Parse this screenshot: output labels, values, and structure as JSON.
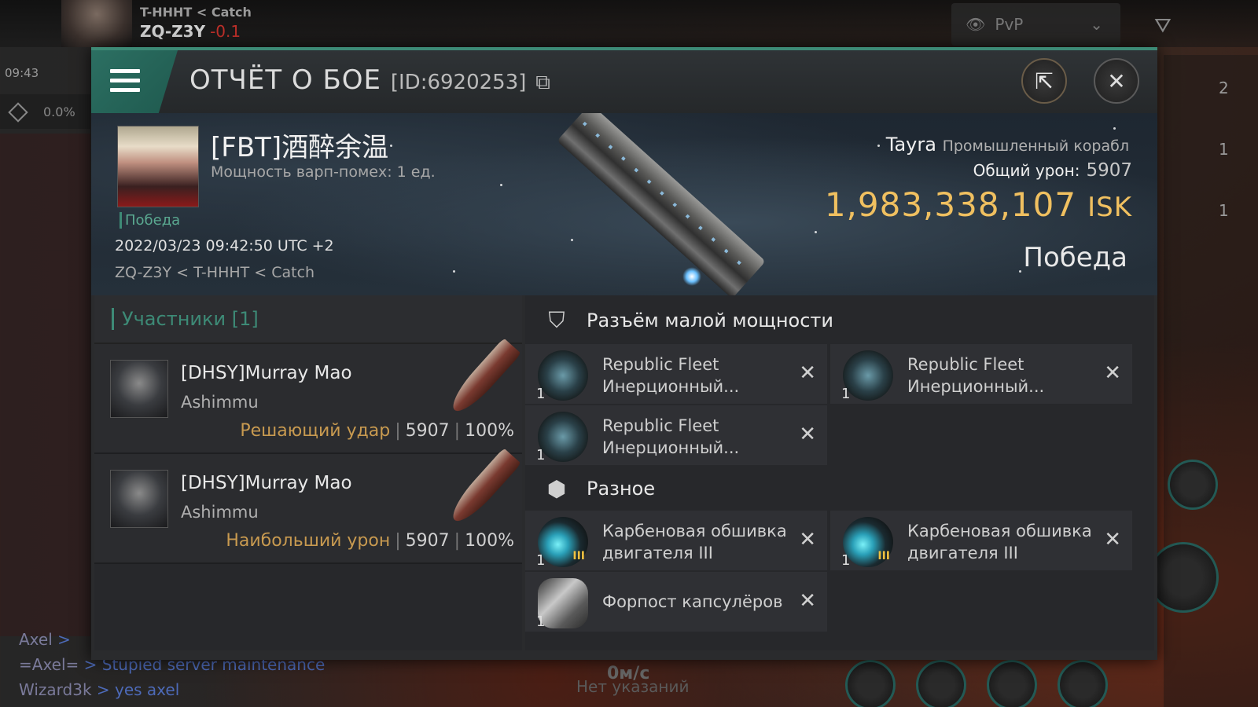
{
  "background": {
    "system_sub": "T-HHHT",
    "system_sub_arrow": "<",
    "system_sub_catch": "Catch",
    "system_name": "ZQ-Z3Y",
    "system_security": "-0.1",
    "clock": "09:43",
    "percent": "0.0%",
    "pvp_label": "PvP",
    "right_counts": [
      "2",
      "1",
      "1"
    ],
    "chat": [
      {
        "name": "Axel",
        "text": "> "
      },
      {
        "name": "=Axel=",
        "text": "> Stupied server maintenance"
      },
      {
        "name": "Wizard3k",
        "text": "> yes axel"
      }
    ],
    "speed": "0м/с",
    "no_target": "Нет указаний"
  },
  "header": {
    "title": "ОТЧЁТ О БОЕ",
    "report_id": "[ID:6920253]",
    "copy_icon": "copy-icon",
    "share_icon": "share-icon",
    "close_icon": "close-icon"
  },
  "victim": {
    "name": "[FBT]酒醉余温",
    "warp_disruption": "Мощность варп-помех: 1 ед.",
    "result_tag": "Победа",
    "datetime": "2022/03/23 09:42:50 UTC +2",
    "location": "ZQ-Z3Y < T-HHHT < Catch",
    "ship_name": "Tayra",
    "ship_class": "Промышленный корабл",
    "total_damage_label": "Общий урон:",
    "total_damage": "5907",
    "isk_value": "1,983,338,107",
    "isk_unit": "ISK",
    "outcome": "Победа"
  },
  "participants": {
    "header": "Участники [1]",
    "rows": [
      {
        "name": "[DHSY]Murray Mao",
        "ship": "Ashimmu",
        "role": "Решающий удар",
        "damage": "5907",
        "percent": "100%"
      },
      {
        "name": "[DHSY]Murray Mao",
        "ship": "Ashimmu",
        "role": "Наибольший урон",
        "damage": "5907",
        "percent": "100%"
      }
    ]
  },
  "modules": {
    "low_slot_title": "Разъём малой мощности",
    "low_slot_items": [
      {
        "qty": "1",
        "name": "Republic Fleet\nИнерционный..."
      },
      {
        "qty": "1",
        "name": "Republic Fleet\nИнерционный..."
      },
      {
        "qty": "1",
        "name": "Republic Fleet\nИнерционный..."
      }
    ],
    "misc_title": "Разное",
    "misc_items": [
      {
        "qty": "1",
        "name": "Карбеновая обшивка\n двигателя III"
      },
      {
        "qty": "1",
        "name": "Карбеновая обшивка\n двигателя III"
      },
      {
        "qty": "1",
        "name": "Форпост капсулёров"
      }
    ],
    "remove_glyph": "✕"
  },
  "colors": {
    "accent": "#3d8a76",
    "isk": "#f0c060",
    "role": "#c89a50",
    "security": "#c0302a"
  }
}
